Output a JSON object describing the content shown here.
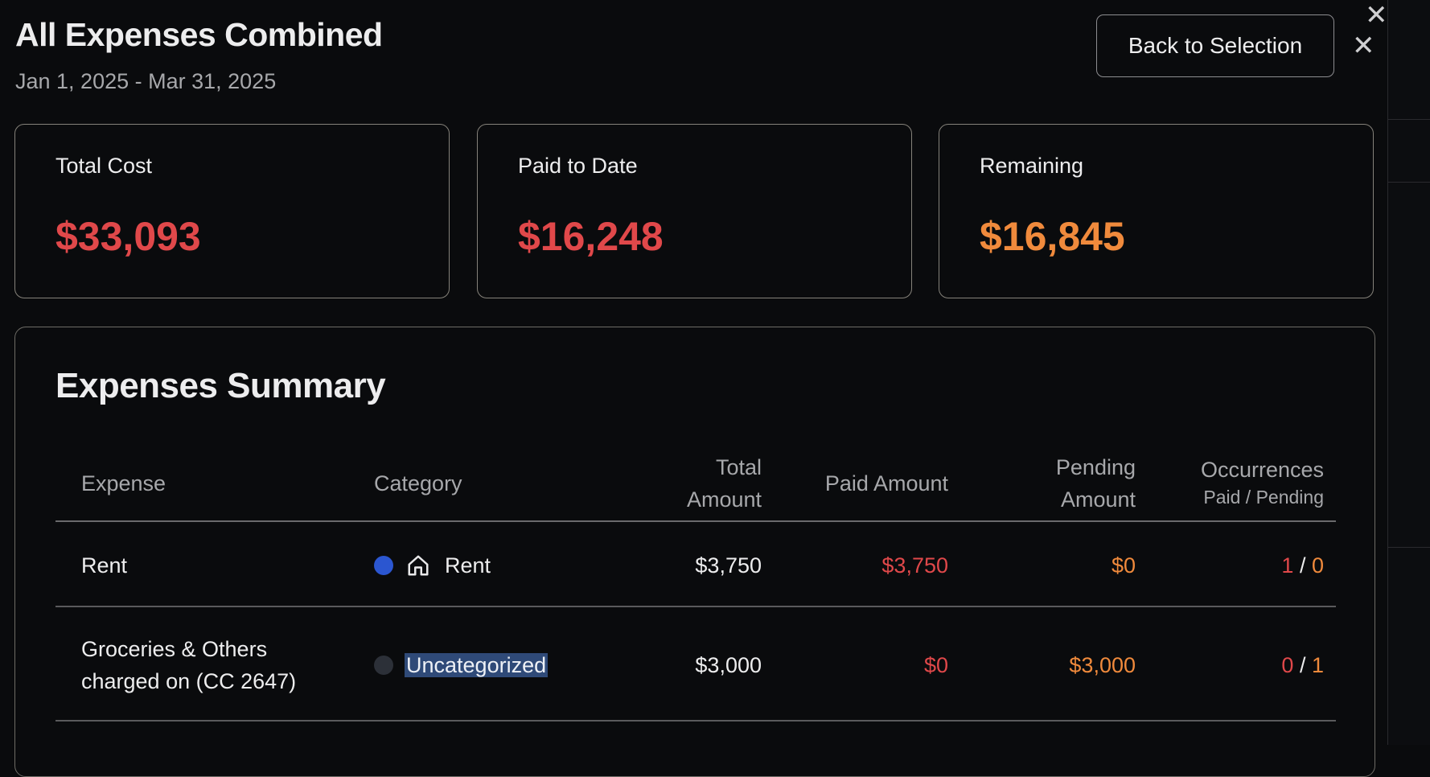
{
  "header": {
    "title": "All Expenses Combined",
    "date_range": "Jan 1, 2025 - Mar 31, 2025",
    "back_label": "Back to Selection",
    "close_icon": "close-icon"
  },
  "stats": [
    {
      "label": "Total Cost",
      "value": "$33,093",
      "color": "#e0484a"
    },
    {
      "label": "Paid to Date",
      "value": "$16,248",
      "color": "#e0484a"
    },
    {
      "label": "Remaining",
      "value": "$16,845",
      "color": "#f08a3c"
    }
  ],
  "summary": {
    "title": "Expenses Summary",
    "columns": {
      "expense": "Expense",
      "category": "Category",
      "total_line1": "Total",
      "total_line2": "Amount",
      "paid": "Paid Amount",
      "pending_line1": "Pending",
      "pending_line2": "Amount",
      "occurrences": "Occurrences",
      "occurrences_sub": "Paid / Pending"
    },
    "rows": [
      {
        "expense_line1": "Rent",
        "category": "Rent",
        "category_color": "#2b56d0",
        "category_icon": "house-icon",
        "total": "$3,750",
        "paid": "$3,750",
        "pending": "$0",
        "occ_paid": "1",
        "occ_sep": "/",
        "occ_pending": "0"
      },
      {
        "expense_line1": "Groceries & Others",
        "expense_line2": "charged on (CC 2647)",
        "category": "Uncategorized",
        "category_color": "#2c3038",
        "total": "$3,000",
        "paid": "$0",
        "pending": "$3,000",
        "occ_paid": "0",
        "occ_sep": "/",
        "occ_pending": "1"
      }
    ]
  },
  "colors": {
    "paid_red": "#e0484a",
    "pending_orange": "#f08a3c",
    "highlight_bg": "#2f4a78"
  }
}
